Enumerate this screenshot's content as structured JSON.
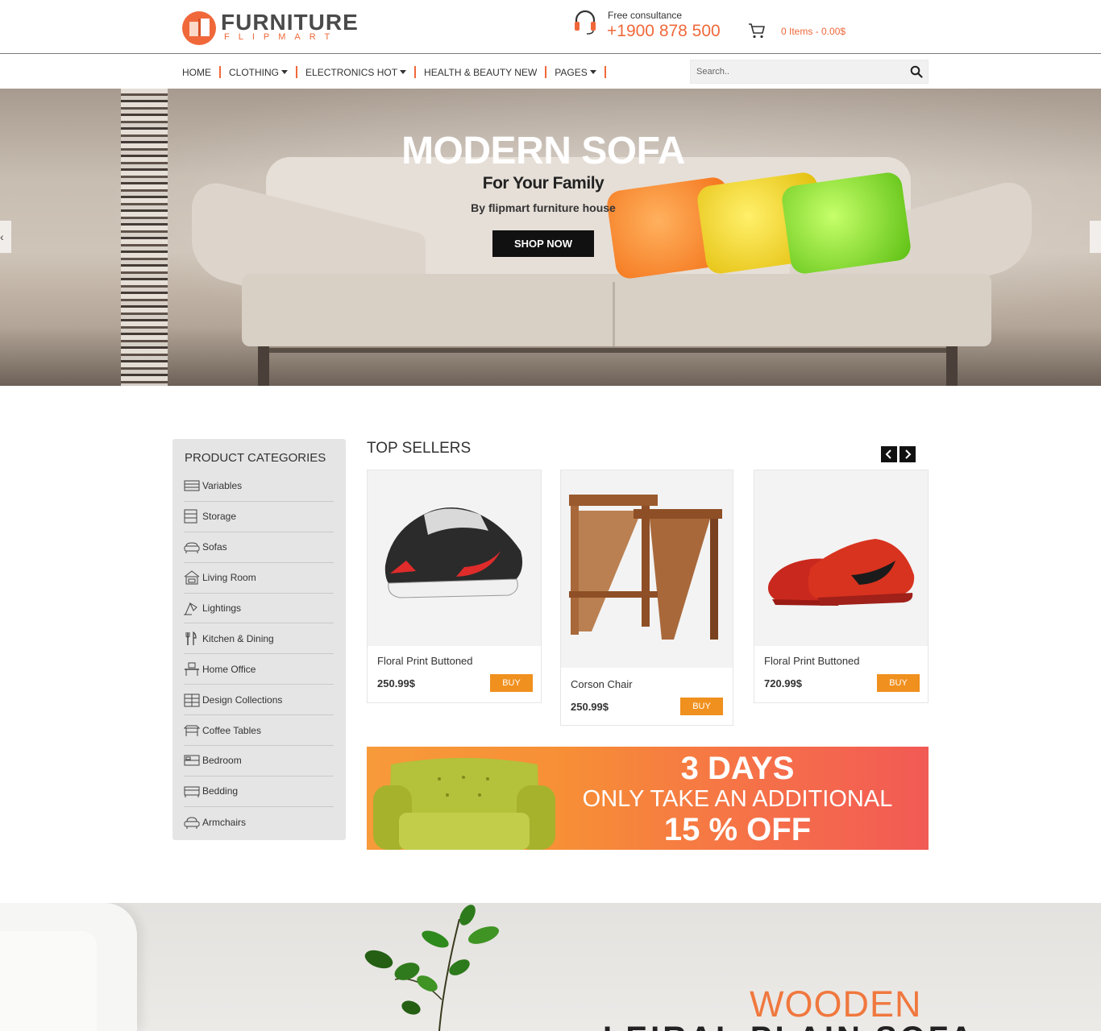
{
  "header": {
    "logo_title": "FURNITURE",
    "logo_sub": "FLIPMART",
    "support_label": "Free consultance",
    "support_phone": "+1900 878 500",
    "cart_text": "0 Items - 0.00$"
  },
  "nav": {
    "items": [
      "HOME",
      "CLOTHING",
      "ELECTRONICS HOT",
      "HEALTH & BEAUTY NEW",
      "PAGES"
    ],
    "search_placeholder": "Search.."
  },
  "hero": {
    "title": "MODERN SOFA",
    "subtitle": "For Your Family",
    "byline": "By flipmart furniture house",
    "button": "SHOP NOW"
  },
  "sidebar": {
    "title": "PRODUCT CATEGORIES",
    "categories": [
      "Variables",
      "Storage",
      "Sofas",
      "Living Room",
      "Lightings",
      "Kitchen & Dining",
      "Home Office",
      "Design Collections",
      "Coffee Tables",
      "Bedroom",
      "Bedding",
      "Armchairs"
    ]
  },
  "top_sellers": {
    "title": "TOP SELLERS",
    "products": [
      {
        "name": "Floral Print Buttoned",
        "price": "250.99$",
        "buy": "BUY"
      },
      {
        "name": "Corson Chair",
        "price": "250.99$",
        "buy": "BUY"
      },
      {
        "name": "Floral Print Buttoned",
        "price": "720.99$",
        "buy": "BUY"
      }
    ]
  },
  "promo": {
    "line1": "3 DAYS",
    "line2": "ONLY TAKE AN ADDITIONAL",
    "line3": "15 % OFF"
  },
  "bottom_banner": {
    "line1": "WOODEN",
    "line2": "LEIRAL PLAIN SOFA"
  },
  "colors": {
    "accent": "#f0683a",
    "buy_button": "#f0901e",
    "dark": "#111111"
  }
}
